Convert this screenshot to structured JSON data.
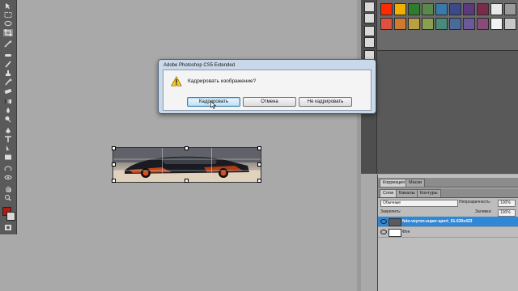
{
  "dialog": {
    "title": "Adobe Photoshop CS5 Extended",
    "message": "Кадрировать изображение?",
    "buttons": {
      "crop": "Кадрировать",
      "cancel": "Отмена",
      "dont_crop": "Не кадрировать"
    }
  },
  "tools": [
    "move-icon",
    "marquee-icon",
    "lasso-icon",
    "quick-select-icon",
    "crop-icon",
    "eyedropper-icon",
    "healing-icon",
    "brush-icon",
    "clone-stamp-icon",
    "history-brush-icon",
    "eraser-icon",
    "gradient-icon",
    "blur-icon",
    "dodge-icon",
    "pen-icon",
    "type-icon",
    "path-select-icon",
    "shape-icon",
    "3d-rotate-icon",
    "3d-orbit-icon",
    "hand-icon",
    "zoom-icon"
  ],
  "colors": {
    "foreground": "#b01a12",
    "background": "#d8d8d8",
    "selected_layer": "#2f87d6"
  },
  "swatches": [
    "#ff2a00",
    "#f0b000",
    "#2e7d2e",
    "#5a8a4a",
    "#3a7aa8",
    "#3a4a8a",
    "#5a3a7a",
    "#7a2a4a",
    "#e8e8e8",
    "#9a9a9a",
    "#e05040",
    "#d07a30",
    "#b8a040",
    "#8aa050",
    "#4a8a7a",
    "#4a6a9a",
    "#6a5a9a",
    "#8a4a7a",
    "#f2f2f2",
    "#c8c8c8"
  ],
  "layers_panel": {
    "top_tabs": [
      "Коррекция",
      "Маски"
    ],
    "tabs": [
      "Слои",
      "Каналы",
      "Контуры"
    ],
    "blend_mode": "Обычные",
    "opacity_label": "Непрозрачность:",
    "opacity_value": "100%",
    "lock_label": "Закрепить:",
    "fill_label": "Заливка:",
    "fill_value": "100%",
    "layers": [
      {
        "name": "foto-veyron-super-sport_01-630x433",
        "selected": true
      },
      {
        "name": "Фон",
        "selected": false
      }
    ]
  }
}
